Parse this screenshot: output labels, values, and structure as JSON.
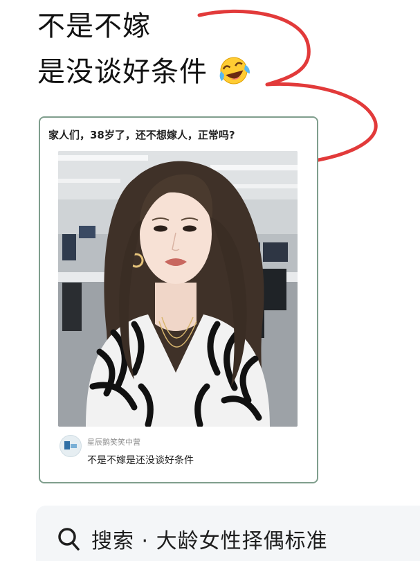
{
  "headline": {
    "line1": "不是不嫁",
    "line2": "是没谈好条件",
    "emoji": "laughing-crying-emoji"
  },
  "post": {
    "question": "家人们，38岁了，还不想嫁人，正常吗?",
    "photo": "portrait-photo-office",
    "comment": {
      "username": "星辰鹅笑笑中营",
      "text": "不是不嫁是还没谈好条件"
    }
  },
  "search": {
    "icon": "search-icon",
    "query": "搜索 · 大龄女性择偶标准"
  },
  "colors": {
    "scribble": "#e23a3a",
    "card_border": "#7f9e8d",
    "search_bg": "#f4f6f8"
  }
}
